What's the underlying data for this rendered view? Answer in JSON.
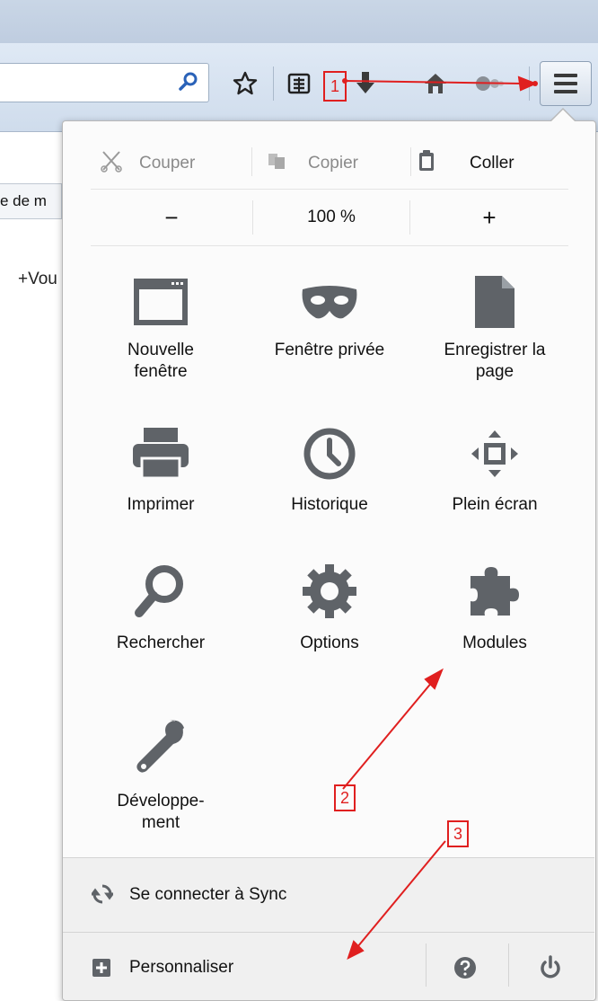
{
  "browser": {
    "background_tab": "e de m",
    "page_text": "+Vou"
  },
  "menu": {
    "edit": {
      "cut": "Couper",
      "copy": "Copier",
      "paste": "Coller"
    },
    "zoom": {
      "minus": "−",
      "level": "100 %",
      "plus": "+"
    },
    "grid": [
      {
        "label": "Nouvelle fenêtre",
        "icon": "window-icon"
      },
      {
        "label": "Fenêtre privée",
        "icon": "mask-icon"
      },
      {
        "label": "Enregistrer la page",
        "icon": "page-icon"
      },
      {
        "label": "Imprimer",
        "icon": "printer-icon"
      },
      {
        "label": "Historique",
        "icon": "clock-icon"
      },
      {
        "label": "Plein écran",
        "icon": "fullscreen-icon"
      },
      {
        "label": "Rechercher",
        "icon": "search-icon"
      },
      {
        "label": "Options",
        "icon": "gear-icon"
      },
      {
        "label": "Modules",
        "icon": "puzzle-icon"
      },
      {
        "label": "Dévelop­pement",
        "label_lines": [
          "Développe-",
          "ment"
        ],
        "icon": "wrench-icon"
      }
    ],
    "sync": "Se connecter à Sync",
    "customize": "Personnaliser"
  },
  "annotations": {
    "c1": "1",
    "c2": "2",
    "c3": "3"
  },
  "colors": {
    "icon": "#5f6368",
    "annotation": "#e01f1f",
    "panel": "#fbfbfb",
    "footer": "#f0f0f0"
  }
}
